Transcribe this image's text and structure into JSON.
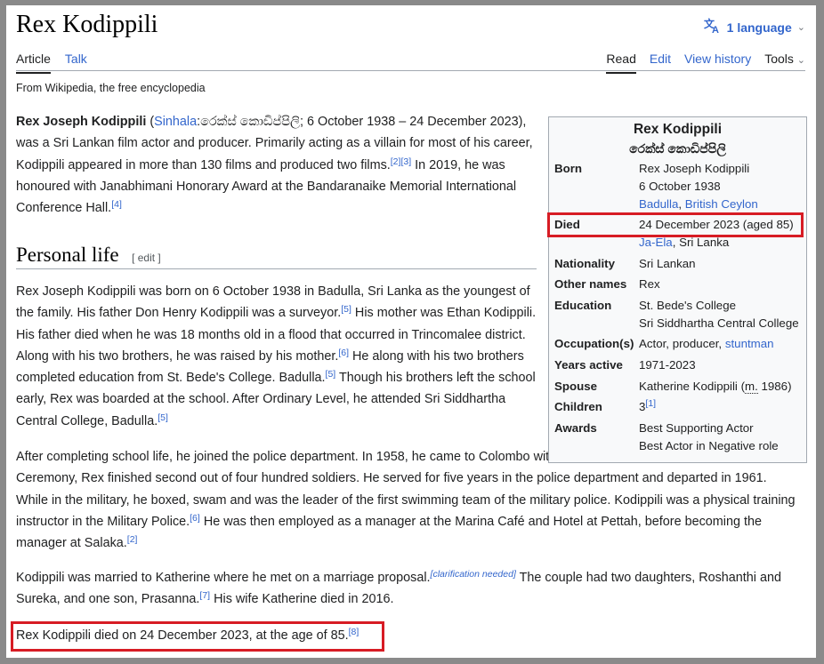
{
  "page": {
    "title": "Rex Kodippili",
    "language_label": "1 language",
    "tabs_left": [
      "Article",
      "Talk"
    ],
    "tabs_right": [
      "Read",
      "Edit",
      "View history",
      "Tools"
    ],
    "from": "From Wikipedia, the free encyclopedia"
  },
  "intro": {
    "name_bold": "Rex Joseph Kodippili",
    "sinhala_link": "Sinhala",
    "sinhala_text": ":රෙක්ස් කොඩිප්පිලි",
    "rest1": "; 6 October 1938 – 24 December 2023), was a Sri Lankan film actor and producer. Primarily acting as a villain for most of his career, Kodippili appeared in more than 130 films and produced two films.",
    "ref2": "[2]",
    "ref3": "[3]",
    "rest2": " In 2019, he was honoured with Janabhimani Honorary Award at the Bandaranaike Memorial International Conference Hall.",
    "ref4": "[4]"
  },
  "section": {
    "heading": "Personal life",
    "edit_label": "[ edit ]"
  },
  "para2": {
    "t1": "Rex Joseph Kodippili was born on 6 October 1938 in Badulla, Sri Lanka as the youngest of the family. His father Don Henry Kodippili was a surveyor.",
    "r1": "[5]",
    "t2": " His mother was Ethan Kodippili. His father died when he was 18 months old in a flood that occurred in Trincomalee district. Along with his two brothers, he was raised by his mother.",
    "r2": "[6]",
    "t3": " He along with his two brothers completed education from St. Bede's College. Badulla.",
    "r3": "[5]",
    "t4": " Though his brothers left the school early, Rex was boarded at the school. After Ordinary Level, he attended Sri Siddhartha Central College, Badulla.",
    "r4": "[5]"
  },
  "para3": {
    "t1": "After completing school life, he joined the police department. In 1958, he came to Colombo with the job. At the Apprentice Passing Out Ceremony, Rex finished second out of four hundred soldiers. He served for five years in the police department and departed in 1961. While in the military, he boxed, swam and was the leader of the first swimming team of the military police. Kodippili was a physical training instructor in the Military Police.",
    "r1": "[6]",
    "t2": " He was then employed as a manager at the Marina Café and Hotel at Pettah, before becoming the manager at Salaka.",
    "r2": "[2]"
  },
  "para4": {
    "t1": "Kodippili was married to Katherine where he met on a marriage proposal.",
    "cn": "[clarification needed]",
    "t2": " The couple had two daughters, Roshanthi and Sureka, and one son, Prasanna.",
    "r1": "[7]",
    "t3": " His wife Katherine died in 2016."
  },
  "para5": {
    "t1": "Rex Kodippili died on 24 December 2023, at the age of 85.",
    "r1": "[8]"
  },
  "infobox": {
    "title": "Rex Kodippili",
    "subtitle": "රෙක්ස් කොඩිප්පිලි",
    "born_label": "Born",
    "born_name": "Rex Joseph Kodippili",
    "born_date": "6 October 1938",
    "born_place_link1": "Badulla",
    "born_place_sep": ", ",
    "born_place_link2": "British Ceylon",
    "died_label": "Died",
    "died_date": "24 December 2023 (aged 85)",
    "died_place_link": "Ja-Ela",
    "died_place_rest": ", Sri Lanka",
    "nationality_label": "Nationality",
    "nationality": "Sri Lankan",
    "other_names_label": "Other names",
    "other_names": "Rex",
    "education_label": "Education",
    "education_1": "St. Bede's College",
    "education_2": "Sri Siddhartha Central College",
    "occupation_label": "Occupation(s)",
    "occupation_text": "Actor, producer, ",
    "occupation_link": "stuntman",
    "years_label": "Years active",
    "years": "1971-2023",
    "spouse_label": "Spouse",
    "spouse_name": "Katherine Kodippili (",
    "spouse_m": "m.",
    "spouse_year": " 1986)",
    "children_label": "Children",
    "children": "3",
    "children_ref": "[1]",
    "awards_label": "Awards",
    "awards_1": "Best Supporting Actor",
    "awards_2": "Best Actor in Negative role"
  },
  "colors": {
    "link": "#3366cc",
    "highlight": "#d71c24",
    "text": "#202122",
    "infobox_bg": "#f8f9fa"
  }
}
